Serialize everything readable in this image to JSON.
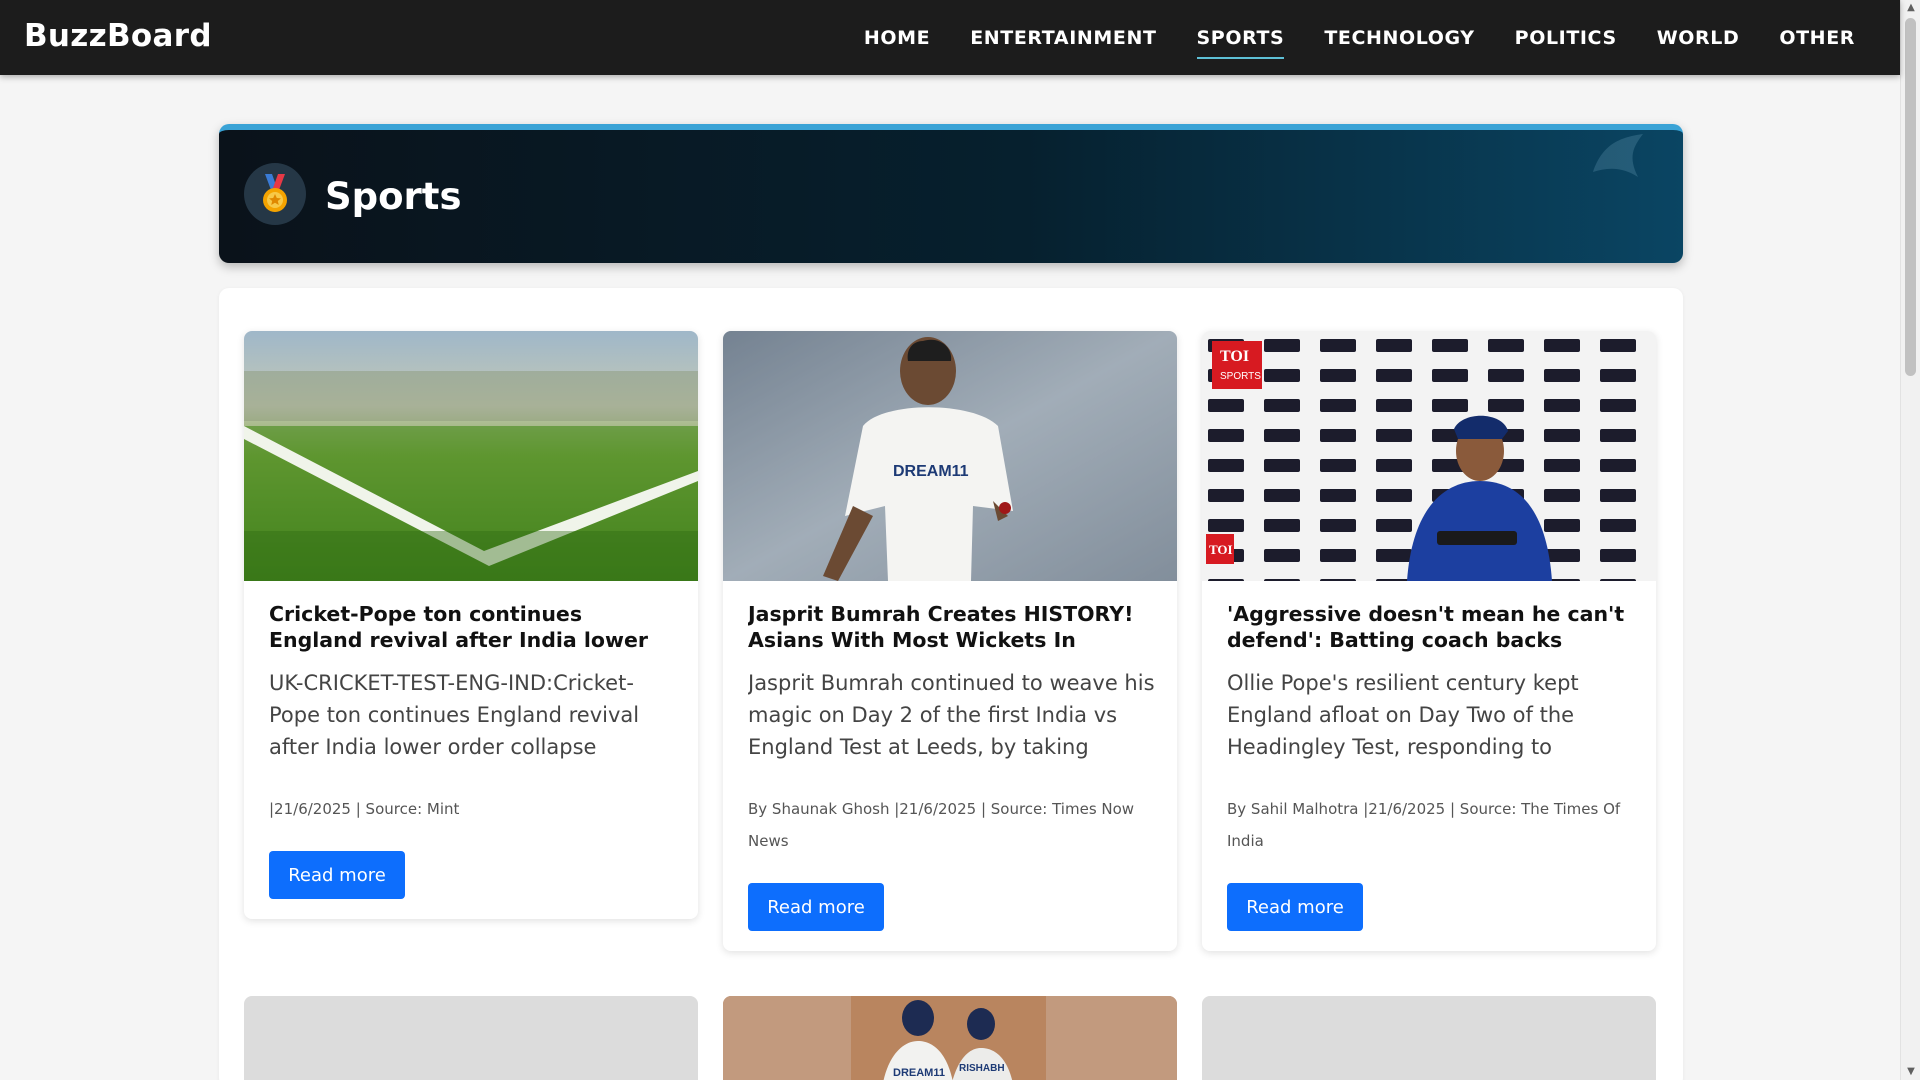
{
  "brand": "BuzzBoard",
  "nav": {
    "items": [
      "HOME",
      "ENTERTAINMENT",
      "SPORTS",
      "TECHNOLOGY",
      "POLITICS",
      "WORLD",
      "OTHER"
    ],
    "active": "SPORTS"
  },
  "hero": {
    "title": "Sports",
    "icon": "medal-icon"
  },
  "articles": [
    {
      "title": "Cricket-Pope ton continues England revival after India lower order collapse",
      "description": "UK-CRICKET-TEST-ENG-IND:Cricket-Pope ton continues England revival after India lower order collapse",
      "meta": "|21/6/2025 | Source: Mint",
      "button": "Read more",
      "image": "grass-field-image"
    },
    {
      "title": "Jasprit Bumrah Creates HISTORY! Asians With Most Wickets In SENA...",
      "description": "Jasprit Bumrah continued to weave his magic on Day 2 of the first India vs England Test at Leeds, by taking three...",
      "meta": "By Shaunak Ghosh |21/6/2025 | Source: Times Now News",
      "button": "Read more",
      "image": "cricket-bowler-image",
      "image_text": "DREAM11"
    },
    {
      "title": "'Aggressive doesn't mean he can't defend': Batting coach backs Pant,...",
      "description": "Ollie Pope's resilient century kept England afloat on Day Two of the Headingley Test, responding to India's...",
      "meta": "By Sahil Malhotra |21/6/2025 | Source: The Times Of India",
      "button": "Read more",
      "image": "press-conference-image",
      "image_text": [
        "TOI",
        "SPORTS"
      ]
    }
  ],
  "second_row": [
    {
      "image": "placeholder-image"
    },
    {
      "image": "cricket-batters-image",
      "image_text": [
        "DREAM11",
        "RISHABH"
      ]
    },
    {
      "image": "placeholder-image"
    }
  ],
  "colors": {
    "navbar": "#1c1c1c",
    "accent": "#0d6efd",
    "hero_border": "#3aa3d6",
    "active_underline": "#5ec0d6"
  }
}
